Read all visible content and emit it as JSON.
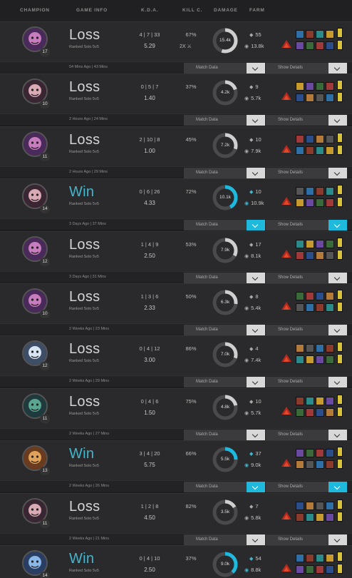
{
  "header": {
    "champion": "CHAMPION",
    "game_info": "GAME INFO",
    "kda": "K.D.A.",
    "kill_c": "KILL C.",
    "damage": "DAMAGE",
    "farm": "FARM"
  },
  "buttons": {
    "match_data": "Match Data",
    "show_details": "Show Details"
  },
  "matches": [
    {
      "level": "17",
      "result": "Loss",
      "mode": "Ranked Solo 5v5",
      "kda": "4 | 7 | 33",
      "kda_ratio": "5.29",
      "kill_p": "67%",
      "multi": "2X",
      "damage": "15.4k",
      "damage_frac": 0.55,
      "cs": "55",
      "gold": "13.8k",
      "when": "54 Mins Ago  |  43 Mins"
    },
    {
      "level": "10",
      "result": "Loss",
      "mode": "Ranked Solo 5v5",
      "kda": "0 | 5 | 7",
      "kda_ratio": "1.40",
      "kill_p": "37%",
      "multi": "",
      "damage": "4.2k",
      "damage_frac": 0.2,
      "cs": "9",
      "gold": "5.7k",
      "when": "2 Hours Ago  |  24 Mins"
    },
    {
      "level": "11",
      "result": "Loss",
      "mode": "Ranked Solo 5v5",
      "kda": "2 | 10 | 8",
      "kda_ratio": "1.00",
      "kill_p": "45%",
      "multi": "",
      "damage": "7.2k",
      "damage_frac": 0.3,
      "cs": "10",
      "gold": "7.9k",
      "when": "2 Hours Ago  |  29 Mins"
    },
    {
      "level": "14",
      "result": "Win",
      "mode": "Ranked Solo 5v5",
      "kda": "0 | 6 | 26",
      "kda_ratio": "4.33",
      "kill_p": "72%",
      "multi": "",
      "damage": "10.1k",
      "damage_frac": 0.42,
      "cs": "10",
      "gold": "10.9k",
      "when": "3 Days Ago  |  37 Mins"
    },
    {
      "level": "12",
      "result": "Loss",
      "mode": "Ranked Solo 5v5",
      "kda": "1 | 4 | 9",
      "kda_ratio": "2.50",
      "kill_p": "53%",
      "multi": "",
      "damage": "7.9k",
      "damage_frac": 0.33,
      "cs": "17",
      "gold": "8.1k",
      "when": "3 Days Ago  |  31 Mins"
    },
    {
      "level": "10",
      "result": "Loss",
      "mode": "Ranked Solo 5v5",
      "kda": "1 | 3 | 6",
      "kda_ratio": "2.33",
      "kill_p": "50%",
      "multi": "",
      "damage": "6.3k",
      "damage_frac": 0.27,
      "cs": "8",
      "gold": "5.4k",
      "when": "2 Weeks Ago  |  23 Mins"
    },
    {
      "level": "12",
      "result": "Loss",
      "mode": "Ranked Solo 5v5",
      "kda": "0 | 4 | 12",
      "kda_ratio": "3.00",
      "kill_p": "86%",
      "multi": "",
      "damage": "7.0k",
      "damage_frac": 0.3,
      "cs": "4",
      "gold": "7.4k",
      "when": "2 Weeks Ago  |  29 Mins"
    },
    {
      "level": "11",
      "result": "Loss",
      "mode": "Ranked Solo 5v5",
      "kda": "0 | 4 | 6",
      "kda_ratio": "1.50",
      "kill_p": "75%",
      "multi": "",
      "damage": "4.8k",
      "damage_frac": 0.22,
      "cs": "10",
      "gold": "5.7k",
      "when": "2 Weeks Ago  |  27 Mins"
    },
    {
      "level": "13",
      "result": "Win",
      "mode": "Ranked Solo 5v5",
      "kda": "3 | 4 | 20",
      "kda_ratio": "5.75",
      "kill_p": "66%",
      "multi": "",
      "damage": "5.5k",
      "damage_frac": 0.25,
      "cs": "37",
      "gold": "9.0k",
      "when": "2 Weeks Ago  |  26 Mins"
    },
    {
      "level": "11",
      "result": "Loss",
      "mode": "Ranked Solo 5v5",
      "kda": "1 | 2 | 8",
      "kda_ratio": "4.50",
      "kill_p": "82%",
      "multi": "",
      "damage": "3.5k",
      "damage_frac": 0.17,
      "cs": "7",
      "gold": "5.8k",
      "when": "2 Weeks Ago  |  21 Mins"
    },
    {
      "level": "14",
      "result": "Win",
      "mode": "Ranked Solo 5v5",
      "kda": "0 | 4 | 10",
      "kda_ratio": "2.50",
      "kill_p": "37%",
      "multi": "",
      "damage": "9.0k",
      "damage_frac": 0.38,
      "cs": "54",
      "gold": "8.8k",
      "when": ""
    }
  ],
  "colors": {
    "win": "#3fb7cf",
    "loss": "#d4d4d4",
    "accent": "#1fb9dd"
  },
  "icons": {
    "cs": "minion-drop-icon",
    "gold": "coins-icon",
    "expand": "chevron-down-icon",
    "multikill": "swords-icon"
  }
}
